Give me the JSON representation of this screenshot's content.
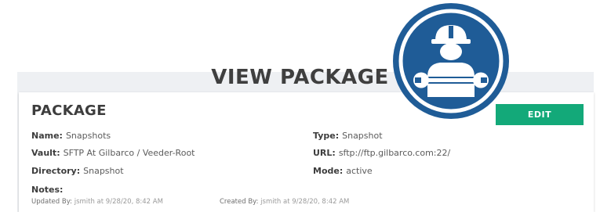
{
  "page": {
    "title": "VIEW PACKAGE"
  },
  "package": {
    "heading": "PACKAGE",
    "edit_label": "EDIT",
    "fields": {
      "name": {
        "label": "Name:",
        "value": "Snapshots"
      },
      "vault": {
        "label": "Vault:",
        "value": "SFTP At Gilbarco / Veeder-Root"
      },
      "directory": {
        "label": "Directory:",
        "value": "Snapshot"
      },
      "notes": {
        "label": "Notes:",
        "value": ""
      },
      "type": {
        "label": "Type:",
        "value": "Snapshot"
      },
      "url": {
        "label": "URL:",
        "value": "sftp://ftp.gilbarco.com:22/"
      },
      "mode": {
        "label": "Mode:",
        "value": "active"
      }
    },
    "meta": {
      "updated": {
        "label": "Updated By:",
        "value": "jsmith at 9/28/20, 8:42 AM"
      },
      "created": {
        "label": "Created By:",
        "value": "jsmith at 9/28/20, 8:42 AM"
      }
    }
  },
  "badge": {
    "icon": "worker-with-wrench-icon",
    "colors": {
      "ring": "#1f5c97",
      "fill": "#ffffff"
    }
  },
  "colors": {
    "accent": "#13a979",
    "background": "#eef0f3",
    "badge_blue": "#1f5c97"
  }
}
